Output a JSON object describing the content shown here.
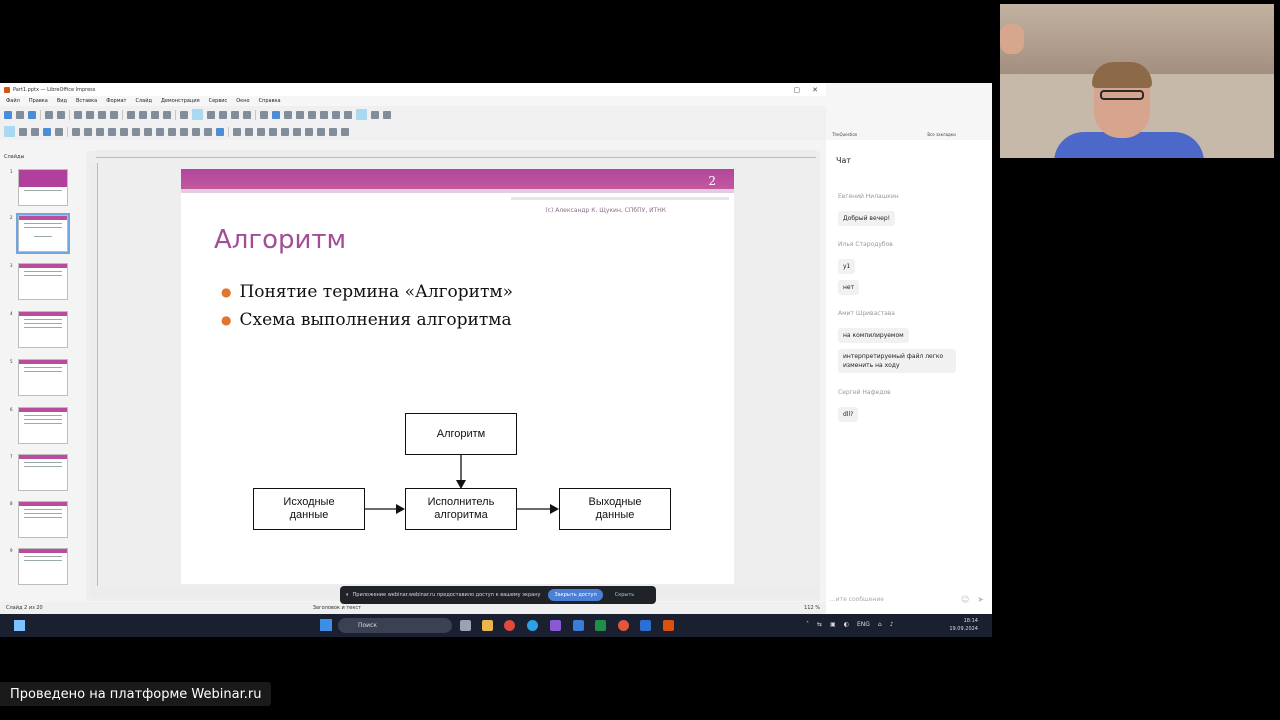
{
  "impress": {
    "title": "Part1.pptx — LibreOffice Impress",
    "window_buttons": [
      "▢",
      "✕"
    ],
    "menu": [
      "Файл",
      "Правка",
      "Вид",
      "Вставка",
      "Формат",
      "Слайд",
      "Демонстрация",
      "Сервис",
      "Окно",
      "Справка"
    ],
    "slides_label": "Слайды",
    "thumb_numbers": [
      "1",
      "2",
      "3",
      "4",
      "5",
      "6",
      "7",
      "8",
      "9"
    ],
    "status_left": "Слайд 2 из 20",
    "status_layout": "Заголовок и текст",
    "zoom": "112 %"
  },
  "slide": {
    "number": "2",
    "credit": "(с) Александр К. Щукин, СПбПУ, ИТНК",
    "title": "Алгоритм",
    "bullets": [
      "Понятие термина «Алгоритм»",
      "Схема выполнения алгоритма"
    ],
    "diagram": {
      "top": "Алгоритм",
      "left": "Исходные данные",
      "center": "Исполнитель алгоритма",
      "right": "Выходные данные"
    }
  },
  "sharebar": {
    "text": "Приложение webinar.webinar.ru предоставило доступ к вашему экрану",
    "stop_label": "Закрыть доступ",
    "hide_label": "Скрыть"
  },
  "chat": {
    "bookmark_left": "TheQuestion",
    "bookmark_right": "Все закладки",
    "title": "Чат",
    "messages": [
      {
        "author": "Евгений Нилашкин",
        "texts": [
          "Добрый вечер!"
        ]
      },
      {
        "author": "Илья Стародубов",
        "texts": [
          "у1",
          "нет"
        ]
      },
      {
        "author": "Амит Шривастава",
        "texts": [
          "на компилируемом",
          "интерпретируемый файл легко изменить на ходу"
        ]
      },
      {
        "author": "Сергей Нафедов",
        "texts": [
          "dll?"
        ]
      }
    ],
    "input_placeholder": "...ите сообщение"
  },
  "taskbar": {
    "search": "Поиск",
    "lang": "ENG",
    "time": "18:14",
    "date": "19.09.2024"
  },
  "caption": "Проведено на платформе Webinar.ru"
}
